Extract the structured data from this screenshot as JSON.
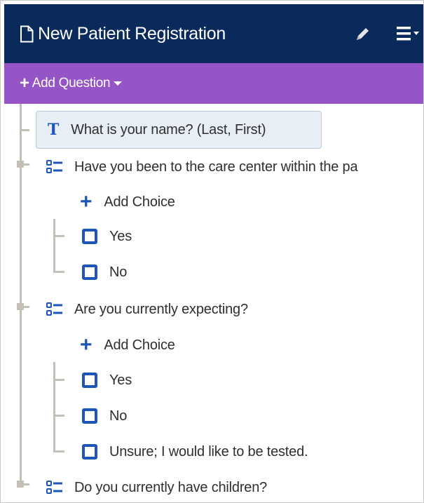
{
  "header": {
    "title": "New Patient Registration",
    "icons": {
      "document": "document-icon",
      "edit": "pencil-icon",
      "menu": "menu-icon"
    }
  },
  "toolbar": {
    "add_question_label": "Add Question"
  },
  "tree": {
    "questions": [
      {
        "type": "text",
        "label": "What is your name? (Last, First)",
        "selected": true
      },
      {
        "type": "choice",
        "label": "Have you been to the care center within the pa",
        "add_choice_label": "Add Choice",
        "choices": [
          "Yes",
          "No"
        ]
      },
      {
        "type": "choice",
        "label": "Are you currently expecting?",
        "add_choice_label": "Add Choice",
        "choices": [
          "Yes",
          "No",
          "Unsure; I would like to be tested."
        ]
      },
      {
        "type": "choice",
        "label": "Do you currently have children?"
      }
    ]
  },
  "colors": {
    "header_bg": "#0a2a5c",
    "toolbar_bg": "#9655c7",
    "icon_blue": "#1d56b8",
    "tree_line": "#c3bfb6",
    "selected_bg": "#e8eef6"
  }
}
